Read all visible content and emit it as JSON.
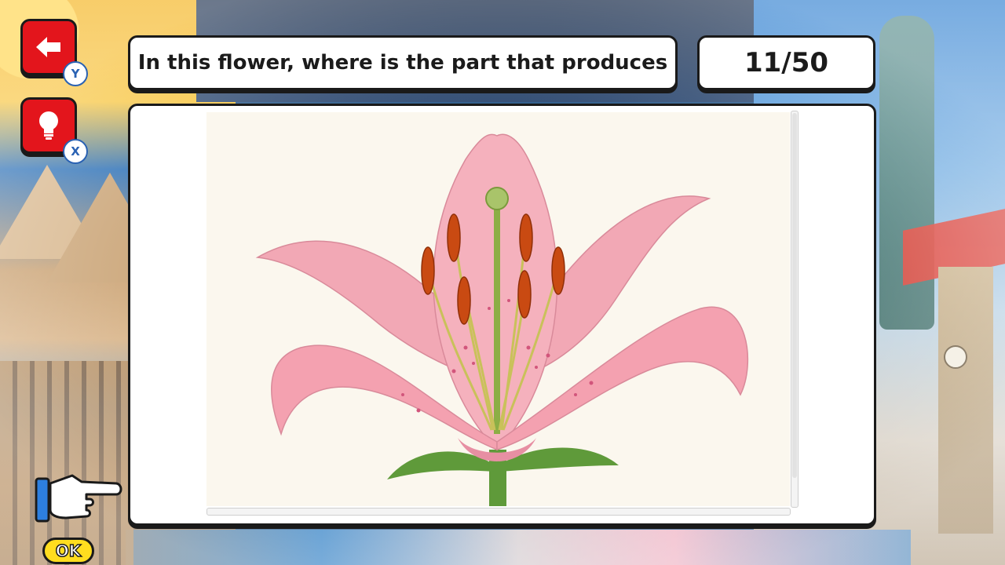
{
  "header": {
    "question": "In this flower, where is the part that produces",
    "progress": "11/50",
    "current_question": 11,
    "total_questions": 50
  },
  "controls": {
    "back_button": {
      "icon": "arrow-left-icon",
      "key": "Y"
    },
    "hint_button": {
      "icon": "lightbulb-icon",
      "key": "X"
    },
    "confirm": {
      "label": "OK",
      "pointer_icon": "pointing-hand-icon"
    }
  },
  "image": {
    "subject": "lily-flower-illustration",
    "colors": {
      "petal": "#f4a7b4",
      "petal_dark": "#e47d92",
      "anther": "#c94a12",
      "filament": "#c9c15a",
      "leaf": "#5f9a3a",
      "background": "#fbf7ee"
    }
  },
  "colors": {
    "button_red": "#e3151c",
    "badge_blue": "#2a62b3",
    "ok_yellow": "#ffdd1f",
    "panel_border": "#1a1a1a"
  }
}
